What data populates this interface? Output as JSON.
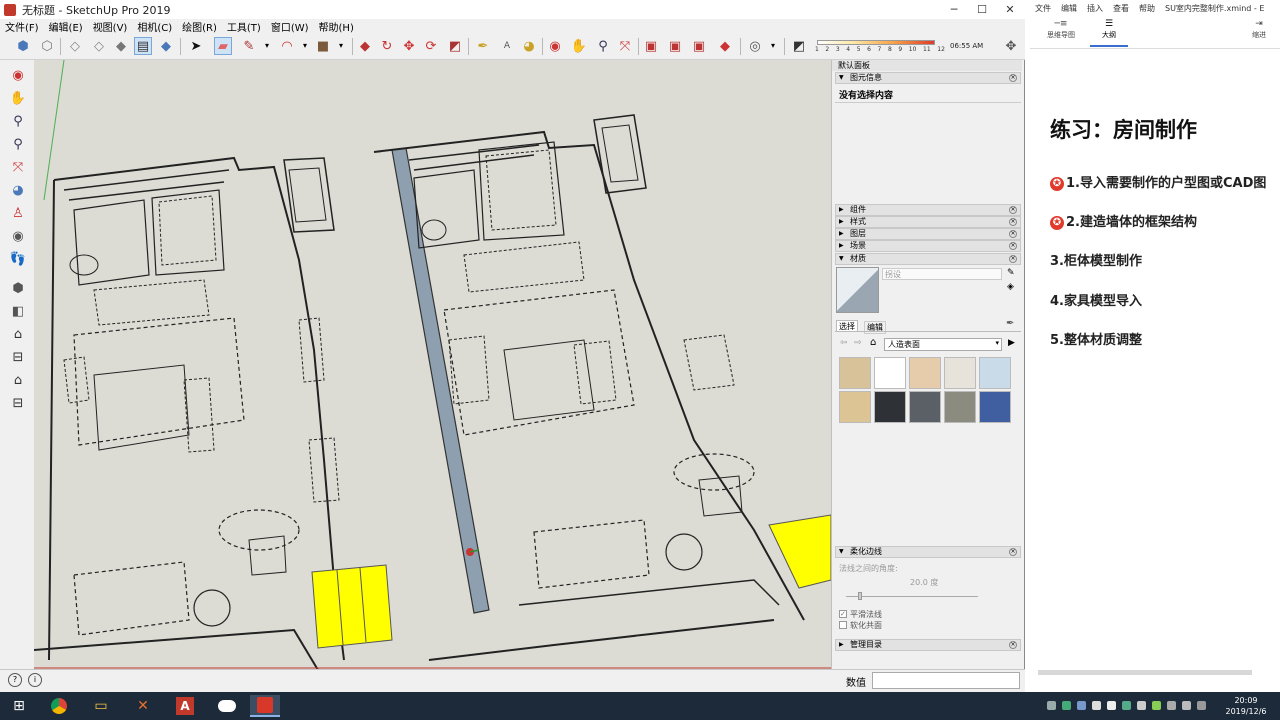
{
  "sketchup": {
    "title": "无标题 - SketchUp Pro 2019",
    "menu": [
      "文件(F)",
      "编辑(E)",
      "视图(V)",
      "相机(C)",
      "绘图(R)",
      "工具(T)",
      "窗口(W)",
      "帮助(H)"
    ],
    "shadow_months": [
      "1",
      "2",
      "3",
      "4",
      "5",
      "6",
      "7",
      "8",
      "9",
      "10",
      "11",
      "12"
    ],
    "shadow_time": "06:55 AM",
    "status": {
      "measure_label": "数值",
      "measure_value": ""
    }
  },
  "tray": {
    "title": "默认面板",
    "entity_info": {
      "header": "图元信息",
      "content": "没有选择内容"
    },
    "sections": [
      "组件",
      "样式",
      "图层",
      "场景"
    ],
    "materials": {
      "header": "材质",
      "name_placeholder": "拐设",
      "tab_select": "选择",
      "tab_edit": "编辑",
      "library": "人造表面",
      "swatch_colors": [
        "#d8c29a",
        "#ffffff",
        "#e6ccab",
        "#e7e3db",
        "#c9dbe9",
        "#dcc494",
        "#2e3135",
        "#5a6066",
        "#8c8b80",
        "#3f5fa0"
      ]
    },
    "soften": {
      "header": "柔化边线",
      "angle_label": "法线之间的角度:",
      "angle_value": "20.0  度",
      "smooth_normals": "平滑法线",
      "soften_coplanar": "软化共面"
    },
    "outliner": {
      "header": "管理目录"
    }
  },
  "xmind": {
    "menu": [
      "文件",
      "编辑",
      "插入",
      "查看",
      "帮助",
      "SU室内完整制作.xmind - E"
    ],
    "tabs": {
      "mindmap": "思维导图",
      "outline": "大纲",
      "indent": "缩进"
    },
    "heading": "练习：房间制作",
    "items": [
      {
        "text": "1.导入需要制作的户型图或CAD图",
        "starred": true
      },
      {
        "text": "2.建造墙体的框架结构",
        "starred": true
      },
      {
        "text": "3.柜体模型制作",
        "starred": false
      },
      {
        "text": "4.家具模型导入",
        "starred": false
      },
      {
        "text": "5.整体材质调整",
        "starred": false
      }
    ]
  },
  "taskbar": {
    "time": "20:09",
    "date": "2019/12/6"
  }
}
